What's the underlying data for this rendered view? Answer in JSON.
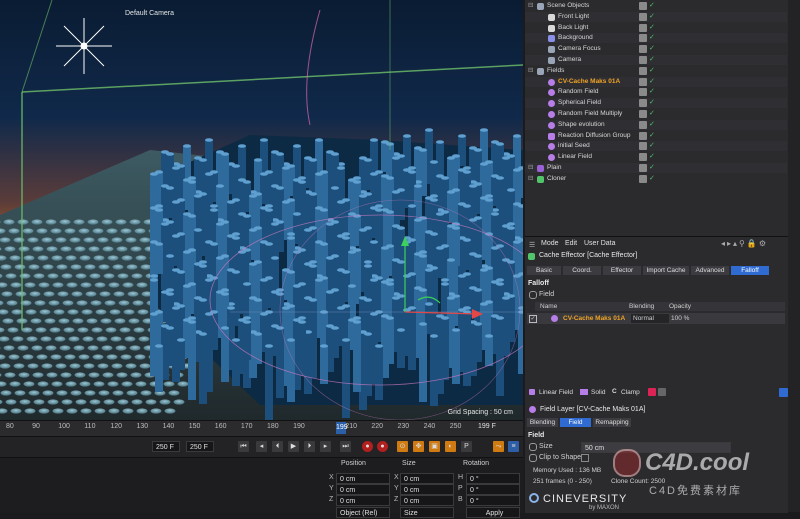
{
  "viewport": {
    "camera_label": "Default Camera",
    "grid_spacing": "Grid Spacing : 50 cm"
  },
  "timeline": {
    "ticks": [
      "80",
      "90",
      "100",
      "110",
      "120",
      "130",
      "140",
      "150",
      "160",
      "170",
      "180",
      "190",
      "199",
      "210",
      "220",
      "230",
      "240",
      "250"
    ],
    "current_frame": "199",
    "frame_box": "199 F"
  },
  "transport": {
    "start_field": "250 F",
    "end_field": "250 F"
  },
  "coords": {
    "position_label": "Position",
    "size_label": "Size",
    "rotation_label": "Rotation",
    "rows": [
      {
        "axis": "X",
        "pos": "0 cm",
        "saxis": "X",
        "size": "0 cm",
        "raxis": "H",
        "rot": "0 °"
      },
      {
        "axis": "Y",
        "pos": "0 cm",
        "saxis": "Y",
        "size": "0 cm",
        "raxis": "P",
        "rot": "0 °"
      },
      {
        "axis": "Z",
        "pos": "0 cm",
        "saxis": "Z",
        "size": "0 cm",
        "raxis": "B",
        "rot": "0 °"
      }
    ],
    "object_select": "Object (Rel)",
    "size_select": "Size",
    "apply_label": "Apply"
  },
  "objects": [
    {
      "name": "Scene Objects",
      "indent": 0,
      "icon": "null",
      "color": "#9aa6b8"
    },
    {
      "name": "Front Light",
      "indent": 1,
      "icon": "light",
      "color": "#d8d8d8"
    },
    {
      "name": "Back Light",
      "indent": 1,
      "icon": "light",
      "color": "#d8d8d8"
    },
    {
      "name": "Background",
      "indent": 1,
      "icon": "bg",
      "color": "#8a8fe8"
    },
    {
      "name": "Camera Focus",
      "indent": 1,
      "icon": "null",
      "color": "#9aa6b8"
    },
    {
      "name": "Camera",
      "indent": 1,
      "icon": "camera",
      "color": "#9aa6b8"
    },
    {
      "name": "Fields",
      "indent": 0,
      "icon": "null",
      "color": "#9aa6b8"
    },
    {
      "name": "CV-Cache Maks 01A",
      "indent": 1,
      "icon": "field",
      "color": "#b77ee8",
      "selected": true
    },
    {
      "name": "Random Field",
      "indent": 1,
      "icon": "field",
      "color": "#b77ee8"
    },
    {
      "name": "Spherical Field",
      "indent": 1,
      "icon": "field",
      "color": "#b77ee8"
    },
    {
      "name": "Random Field Multiply",
      "indent": 1,
      "icon": "field",
      "color": "#b77ee8"
    },
    {
      "name": "Shape evolution",
      "indent": 1,
      "icon": "field",
      "color": "#b77ee8"
    },
    {
      "name": "Reaction Diffusion Group",
      "indent": 1,
      "icon": "folder",
      "color": "#b77ee8"
    },
    {
      "name": "initial Seed",
      "indent": 1,
      "icon": "field",
      "color": "#b77ee8"
    },
    {
      "name": "Linear Field",
      "indent": 1,
      "icon": "field",
      "color": "#b77ee8"
    },
    {
      "name": "Plain",
      "indent": 0,
      "icon": "effector",
      "color": "#9a62d6"
    },
    {
      "name": "Cloner",
      "indent": 0,
      "icon": "cloner",
      "color": "#52c46a"
    }
  ],
  "attr": {
    "menu": [
      "Mode",
      "Edit",
      "User Data"
    ],
    "title": "Cache Effector [Cache Effector]",
    "tabs": [
      {
        "label": "Basic"
      },
      {
        "label": "Coord."
      },
      {
        "label": "Effector"
      },
      {
        "label": "Import Cache"
      },
      {
        "label": "Advanced"
      },
      {
        "label": "Falloff",
        "active": true
      }
    ],
    "section_falloff": "Falloff",
    "field_label": "Field",
    "col_name": "Name",
    "col_blending": "Blending",
    "col_opacity": "Opacity",
    "field_row": {
      "name": "CV-Cache Maks 01A",
      "blending": "Normal",
      "opacity": "100 %"
    },
    "buttons": [
      "Linear Field",
      "Solid",
      "Clamp"
    ],
    "layer_title": "Field Layer [CV-Cache Maks 01A]",
    "layer_tabs": [
      {
        "label": "Blending"
      },
      {
        "label": "Field",
        "active": true
      },
      {
        "label": "Remapping"
      }
    ],
    "section_field": "Field",
    "size_label": "Size",
    "size_value": "50 cm",
    "clip_label": "Clip to Shape",
    "memory": "Memory Used : 136 MB",
    "frames": "251 frames (0 - 250)",
    "clone_count": "Clone Count: 2500"
  },
  "branding": {
    "cineversity": "CINEVERSITY",
    "by_maxon": "by MAXON",
    "wm_main": "C4D.cool",
    "wm_sub": "C4D免费素材库"
  }
}
